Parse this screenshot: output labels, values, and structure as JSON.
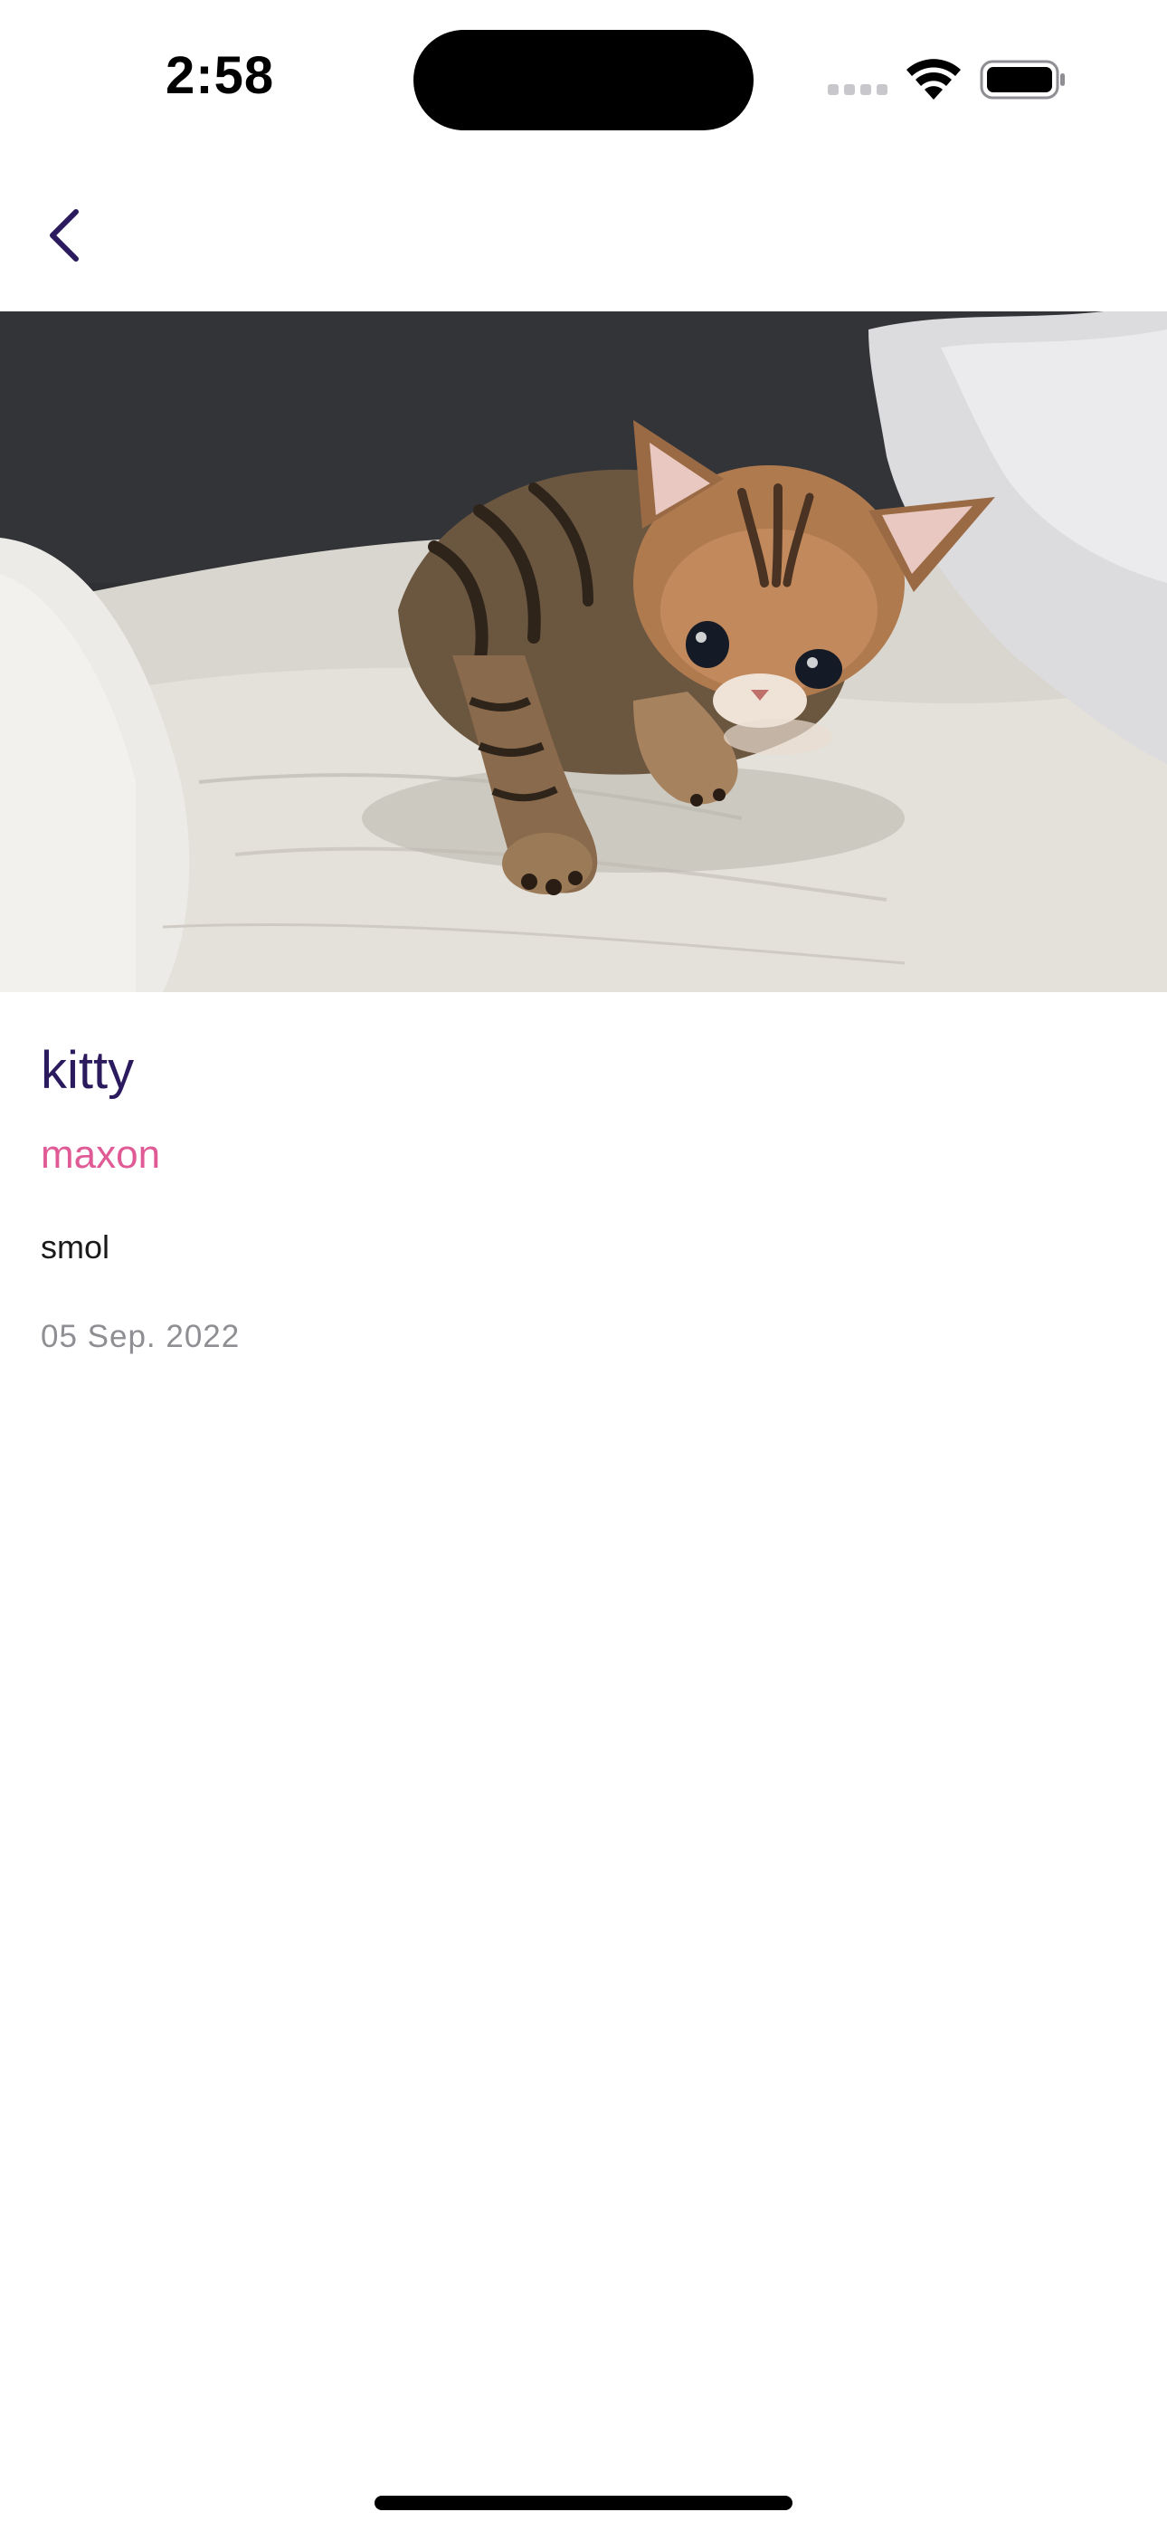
{
  "status_bar": {
    "time": "2:58",
    "icons": [
      "cellular-signal-icon",
      "wifi-icon",
      "battery-icon"
    ]
  },
  "nav": {
    "back_icon": "chevron-left-icon",
    "accent_color": "#2b1a5e"
  },
  "post": {
    "photo_subject": "kitten",
    "title": "kitty",
    "author": "maxon",
    "description": "smol",
    "date": "05 Sep. 2022"
  },
  "colors": {
    "title": "#2b1a5e",
    "author": "#e05a95",
    "date": "#8e8e93"
  }
}
